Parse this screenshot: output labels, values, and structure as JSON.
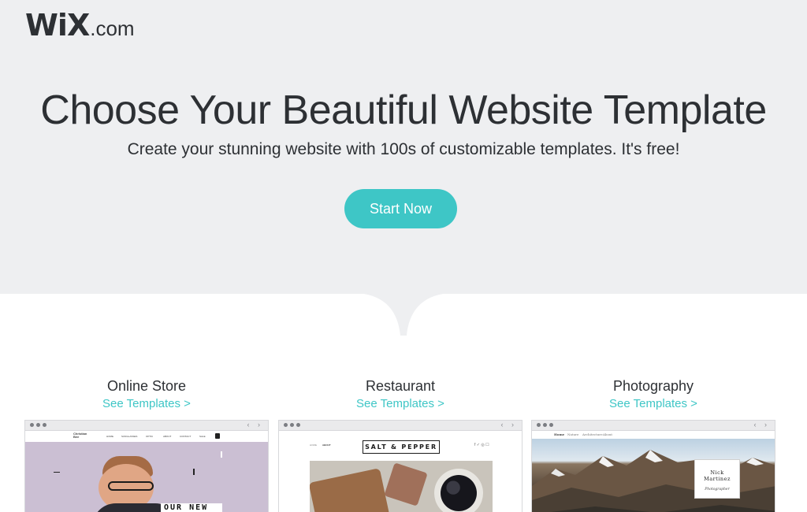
{
  "header": {
    "logo_mark": "WiX",
    "logo_suffix": ".com"
  },
  "hero": {
    "title": "Choose Your Beautiful Website Template",
    "subtitle": "Create your stunning website with 100s of customizable templates. It's free!",
    "cta_label": "Start Now"
  },
  "categories": [
    {
      "title": "Online Store",
      "link": "See Templates >",
      "preview": {
        "logo": "Christian Bee",
        "nav": [
          "HOME",
          "SUNGLASSES",
          "OPTIC",
          "ABOUT",
          "CONTACT",
          "SALE"
        ],
        "banner": "OUR NEW"
      }
    },
    {
      "title": "Restaurant",
      "link": "See Templates >",
      "preview": {
        "nav": [
          "HOME",
          "ABOUT"
        ],
        "logo": "SALT & PEPPER"
      }
    },
    {
      "title": "Photography",
      "link": "See Templates >",
      "preview": {
        "nav": [
          "Home",
          "Nature",
          "Architecture",
          "About"
        ],
        "name_line1": "Nick",
        "name_line2": "Martinez",
        "role": "Photographer"
      }
    }
  ],
  "colors": {
    "accent": "#3ec6c6",
    "hero_bg": "#eeeff1",
    "text": "#2d3034"
  }
}
